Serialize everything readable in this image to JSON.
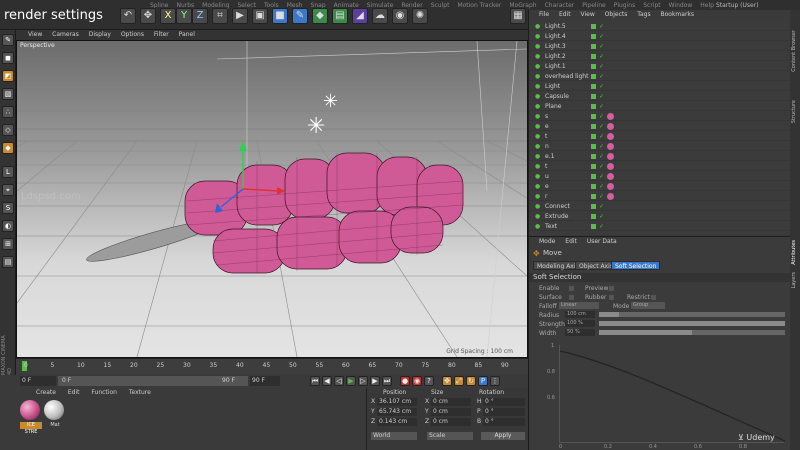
{
  "top": {
    "title": "render settings",
    "menu_items": [
      "Spline",
      "Nurbs",
      "Modeling",
      "Select",
      "Tools",
      "Mesh",
      "Snap",
      "Animate",
      "Simulate",
      "Render",
      "Sculpt",
      "Motion Tracker",
      "MoGraph",
      "Character",
      "Pipeline",
      "Plugins",
      "Script",
      "Window",
      "Help"
    ],
    "axis_buttons": [
      "X",
      "Y",
      "Z"
    ],
    "layout_label": "Startup (User)"
  },
  "viewport": {
    "menu": [
      "View",
      "Cameras",
      "Display",
      "Options",
      "Filter",
      "Panel"
    ],
    "label": "Perspective",
    "grid_info": "Grid Spacing : 100 cm"
  },
  "timeline": {
    "ticks": [
      "0",
      "5",
      "10",
      "15",
      "20",
      "25",
      "30",
      "35",
      "40",
      "45",
      "50",
      "55",
      "60",
      "65",
      "70",
      "75",
      "80",
      "85",
      "90"
    ],
    "start_frame": "0 F",
    "current_frame": "0 F",
    "end_frame": "90 F",
    "end_frame2": "90 F"
  },
  "material": {
    "menu": [
      "Create",
      "Edit",
      "Function",
      "Texture"
    ],
    "mats": [
      {
        "name": "ICE STRE",
        "color": "#c8508a"
      },
      {
        "name": "Mat",
        "color": "#bdbdbd"
      }
    ]
  },
  "coords": {
    "headers": [
      "Position",
      "Size",
      "Rotation"
    ],
    "rows": [
      {
        "axis": "X",
        "pos": "36.107 cm",
        "size_axis": "X",
        "size": "0 cm",
        "rot_axis": "H",
        "rot": "0 °"
      },
      {
        "axis": "Y",
        "pos": "65.743 cm",
        "size_axis": "Y",
        "size": "0 cm",
        "rot_axis": "P",
        "rot": "0 °"
      },
      {
        "axis": "Z",
        "pos": "0.143 cm",
        "size_axis": "Z",
        "size": "0 cm",
        "rot_axis": "B",
        "rot": "0 °"
      }
    ],
    "mode_world": "World",
    "mode_scale": "Scale",
    "apply": "Apply"
  },
  "objects": {
    "menu": [
      "File",
      "Edit",
      "View",
      "Objects",
      "Tags",
      "Bookmarks"
    ],
    "items": [
      {
        "name": "Light.5"
      },
      {
        "name": "Light.4"
      },
      {
        "name": "Light.3"
      },
      {
        "name": "Light.2"
      },
      {
        "name": "Light.1"
      },
      {
        "name": "overhead light"
      },
      {
        "name": "Light"
      },
      {
        "name": "Capsule"
      },
      {
        "name": "Plane"
      },
      {
        "name": "s"
      },
      {
        "name": "e"
      },
      {
        "name": "t"
      },
      {
        "name": "n"
      },
      {
        "name": "e.1"
      },
      {
        "name": "t"
      },
      {
        "name": "u"
      },
      {
        "name": "e"
      },
      {
        "name": "r"
      },
      {
        "name": "Connect"
      },
      {
        "name": "Extrude"
      },
      {
        "name": "Text"
      }
    ]
  },
  "attributes": {
    "menu": [
      "Mode",
      "Edit",
      "User Data"
    ],
    "tool": "Move",
    "tabs": [
      "Modeling Axis",
      "Object Axis",
      "Soft Selection"
    ],
    "section": "Soft Selection",
    "fields": {
      "enable": "Enable",
      "preview": "Preview",
      "surface": "Surface",
      "rubber": "Rubber",
      "restrict": "Restrict",
      "falloff_label": "Falloff",
      "falloff_value": "Linear",
      "mode_label": "Mode",
      "mode_value": "Group",
      "radius_label": "Radius",
      "radius_value": "100 cm",
      "strength_label": "Strength",
      "strength_value": "100 %",
      "width_label": "Width",
      "width_value": "50 %"
    },
    "graph_y": [
      "1",
      "0.8",
      "0.6"
    ],
    "graph_x": [
      "0",
      "0.2",
      "0.4",
      "0.6",
      "0.8"
    ]
  },
  "side_tabs": [
    "Content Browser",
    "Structure",
    "Attributes",
    "Layers"
  ],
  "watermark": {
    "site": "Ldspsd.com",
    "brand": "Udemy"
  },
  "colors": {
    "accent": "#3d77c9",
    "green": "#5bbd4a",
    "pink": "#d45ea0"
  }
}
